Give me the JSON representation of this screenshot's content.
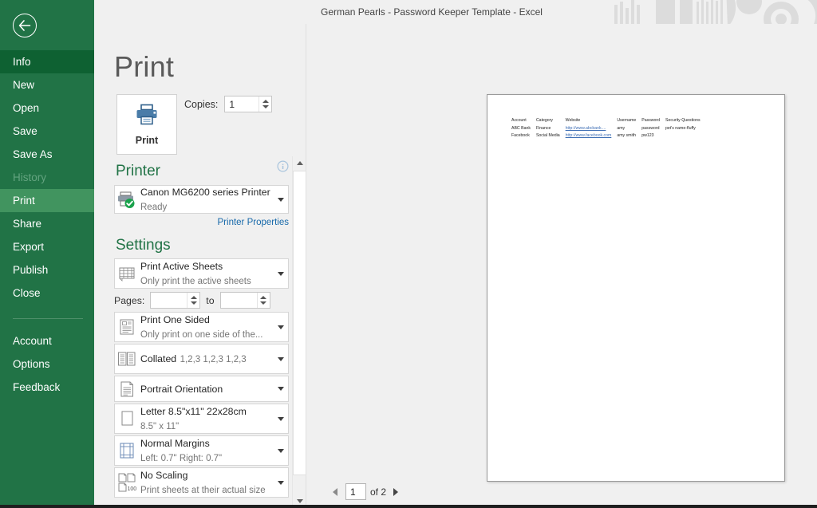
{
  "window": {
    "title": "German Pearls - Password Keeper Template - Excel"
  },
  "sidebar": {
    "back_icon": "back-arrow-icon",
    "items": [
      {
        "label": "Info",
        "state": "hovered"
      },
      {
        "label": "New",
        "state": "normal"
      },
      {
        "label": "Open",
        "state": "normal"
      },
      {
        "label": "Save",
        "state": "normal"
      },
      {
        "label": "Save As",
        "state": "normal"
      },
      {
        "label": "History",
        "state": "disabled"
      },
      {
        "label": "Print",
        "state": "selected"
      },
      {
        "label": "Share",
        "state": "normal"
      },
      {
        "label": "Export",
        "state": "normal"
      },
      {
        "label": "Publish",
        "state": "normal"
      },
      {
        "label": "Close",
        "state": "normal"
      }
    ],
    "footer_items": [
      {
        "label": "Account"
      },
      {
        "label": "Options"
      },
      {
        "label": "Feedback"
      }
    ],
    "colors": {
      "background": "#217346",
      "selected": "#41945f",
      "hovered": "#0e6132",
      "disabled_text": "#63a37f"
    }
  },
  "page": {
    "heading": "Print"
  },
  "print_action": {
    "button_label": "Print",
    "icon": "printer-icon",
    "copies_label": "Copies:",
    "copies_value": "1"
  },
  "printer_section": {
    "title": "Printer",
    "info_icon": "info-icon",
    "selected_printer": "Canon MG6200 series Printer",
    "status": "Ready",
    "properties_link": "Printer Properties"
  },
  "settings_section": {
    "title": "Settings",
    "options": [
      {
        "name": "print-what",
        "icon": "sheets-icon",
        "main": "Print Active Sheets",
        "sub": "Only print the active sheets"
      },
      {
        "name": "sides",
        "icon": "one-sided-icon",
        "main": "Print One Sided",
        "sub": "Only print on one side of the..."
      },
      {
        "name": "collation",
        "icon": "collated-icon",
        "main": "Collated",
        "sub": "1,2,3   1,2,3   1,2,3"
      },
      {
        "name": "orientation",
        "icon": "portrait-icon",
        "main": "Portrait Orientation",
        "sub": ""
      },
      {
        "name": "paper-size",
        "icon": "paper-size-icon",
        "main": "Letter 8.5\"x11\" 22x28cm",
        "sub": "8.5\" x 11\""
      },
      {
        "name": "margins",
        "icon": "margins-icon",
        "main": "Normal Margins",
        "sub": "Left:  0.7\"   Right:  0.7\""
      },
      {
        "name": "scaling",
        "icon": "scaling-icon",
        "main": "No Scaling",
        "sub": "Print sheets at their actual size"
      }
    ],
    "pages_label": "Pages:",
    "pages_from": "",
    "pages_to_label": "to",
    "pages_to": ""
  },
  "preview": {
    "sheet": {
      "headers": [
        "Account",
        "Category",
        "Website",
        "Username",
        "Password",
        "Security Questions"
      ],
      "rows": [
        {
          "account": "ABC Bank",
          "category": "Finance",
          "website": "http://www.abcbank....",
          "username": "amy",
          "password": "password",
          "security": "pet's name-fluffy"
        },
        {
          "account": "Facebook",
          "category": "Social Media",
          "website": "http://www.facebook.com",
          "username": "amy smith",
          "password": "pw123",
          "security": ""
        }
      ]
    },
    "pager": {
      "current_page": "1",
      "of_label": "of 2",
      "prev_icon": "previous-page-icon",
      "next_icon": "next-page-icon"
    }
  }
}
